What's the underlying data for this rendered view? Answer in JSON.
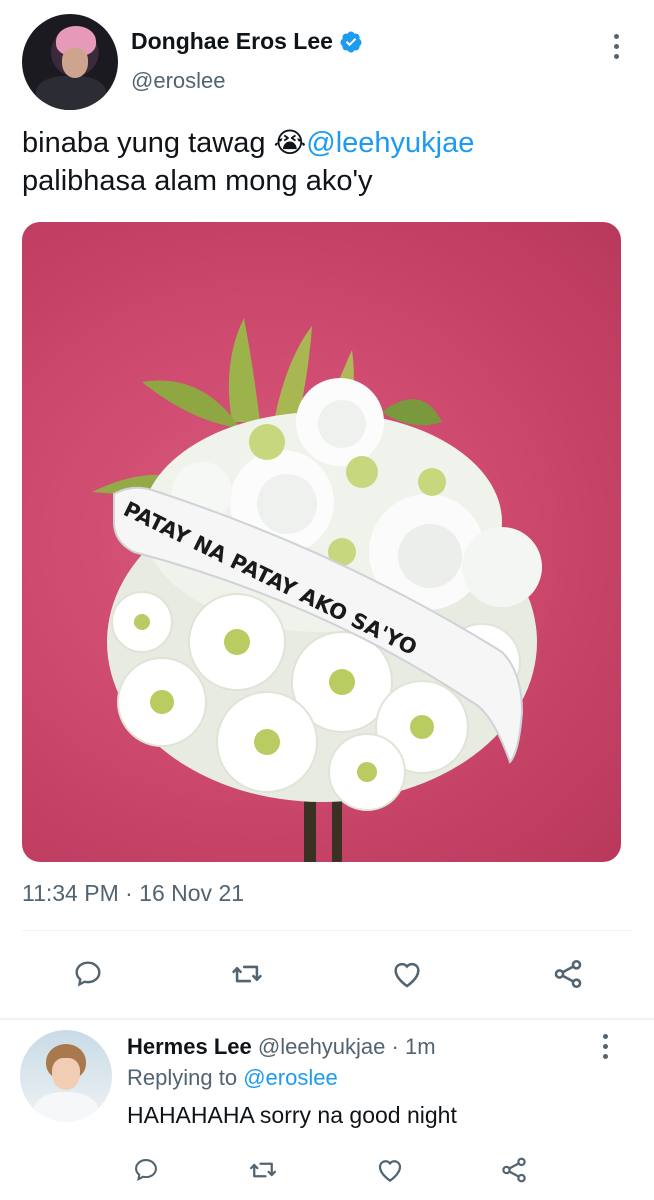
{
  "tweet": {
    "author": {
      "display_name": "Donghae Eros Lee",
      "handle": "@eroslee",
      "verified": true
    },
    "text_line1": "binaba yung tawag ",
    "emoji": "😭",
    "mention": "@leehyukjae",
    "text_line2": "palibhasa alam mong ako'y",
    "media": {
      "ribbon_text": "PATAY NA PATAY AKO SA'YO"
    },
    "timestamp": "11:34 PM · 16 Nov 21",
    "actions": [
      "reply-icon",
      "retweet-icon",
      "like-icon",
      "share-icon"
    ]
  },
  "reply": {
    "author": {
      "display_name": "Hermes Lee",
      "handle": "@leehyukjae",
      "time": "· 1m"
    },
    "replying_to_label": "Replying to",
    "replying_to_handle": "@eroslee",
    "text": "HAHAHAHA sorry na good night",
    "actions": [
      "reply-icon",
      "retweet-icon",
      "like-icon",
      "share-icon"
    ]
  },
  "colors": {
    "accent": "#1d9bf0",
    "text_primary": "#0f1419",
    "text_secondary": "#536471",
    "divider": "#eff3f4",
    "media_background": "#cf4a6f"
  }
}
